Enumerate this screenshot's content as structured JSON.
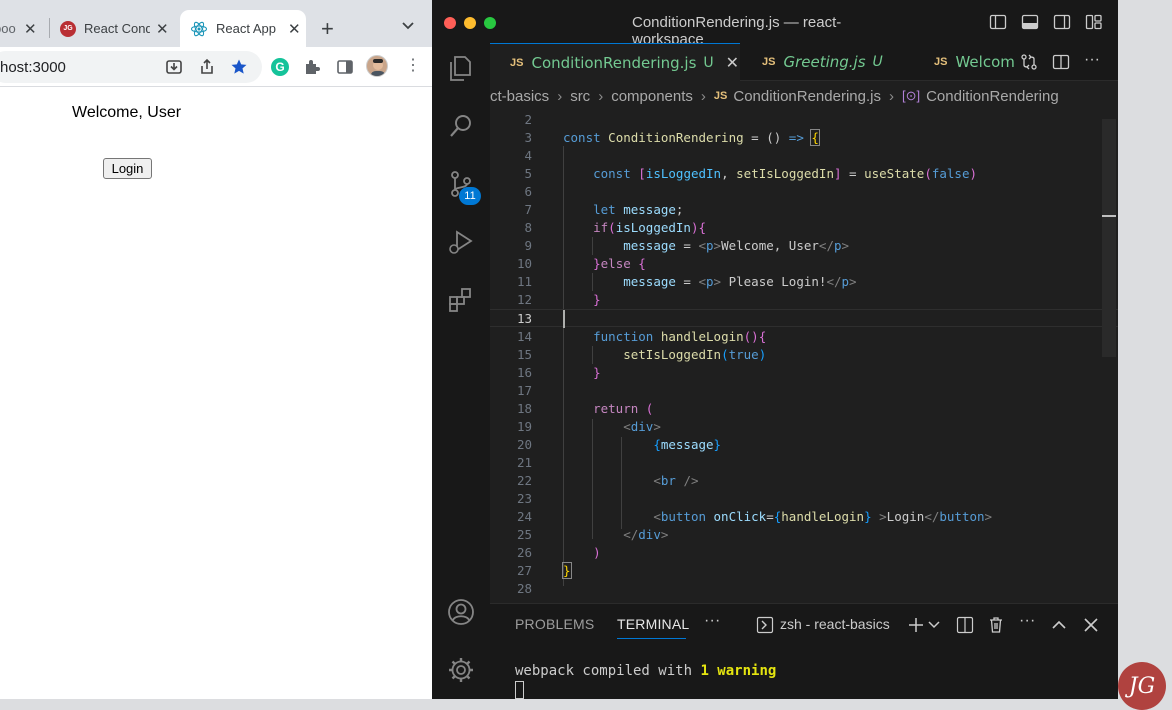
{
  "browser": {
    "tabs": [
      {
        "title": "boot",
        "favicon": "generic-icon"
      },
      {
        "title": "React Cond",
        "favicon": "react-icon-red"
      },
      {
        "title": "React App",
        "favicon": "react-logo-icon",
        "active": true
      }
    ],
    "close_glyph": "✕",
    "new_tab": "+",
    "url": "host:3000",
    "page": {
      "message": "Welcome, User",
      "button": "Login"
    }
  },
  "vscode": {
    "window_title": "ConditionRendering.js — react-workspace",
    "badge_count": "11",
    "tabs": [
      {
        "icon": "JS",
        "name": "ConditionRendering.js",
        "status": "U",
        "close": "✕",
        "active": true
      },
      {
        "icon": "JS",
        "name": "Greeting.js",
        "status": "U",
        "italic": true
      },
      {
        "icon": "JS",
        "name": "Welcom"
      }
    ],
    "breadcrumb": {
      "parts": [
        "ct-basics",
        "src",
        "components"
      ],
      "file_icon": "JS",
      "file": "ConditionRendering.js",
      "symbol_icon": "[⊙]",
      "symbol": "ConditionRendering",
      "sep": "›"
    },
    "code": {
      "line_numbers": [
        "2",
        "3",
        "4",
        "5",
        "6",
        "7",
        "8",
        "9",
        "10",
        "11",
        "12",
        "13",
        "14",
        "15",
        "16",
        "17",
        "18",
        "19",
        "20",
        "21",
        "22",
        "23",
        "24",
        "25",
        "26",
        "27",
        "28"
      ],
      "active_line": "13"
    },
    "panel": {
      "tabs": [
        "PROBLEMS",
        "TERMINAL"
      ],
      "active_tab": "TERMINAL",
      "more": "···",
      "shell": "zsh - react-basics",
      "terminal_prefix": "webpack compiled with ",
      "terminal_warning": "1 warning"
    }
  },
  "colors": {
    "accent": "#0078d4",
    "modified_green": "#73c991",
    "warning_yellow": "#e5e510"
  },
  "watermark": "JG"
}
